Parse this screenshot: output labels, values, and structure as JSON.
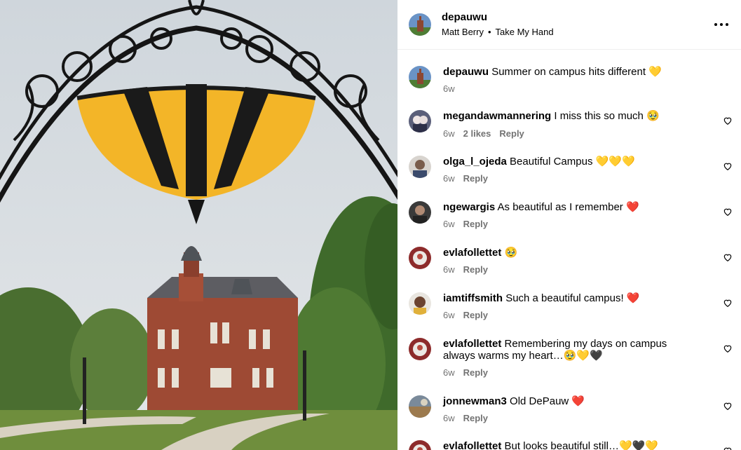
{
  "colors": {
    "gold": "#F3B528",
    "meta_gray": "#737373",
    "red_heart": "#E41E3F"
  },
  "post": {
    "username": "depauwu",
    "audio_artist": "Matt Berry",
    "audio_track": "Take My Hand",
    "more_icon": "more-horizontal-icon"
  },
  "comments": [
    {
      "user": "depauwu",
      "text": "Summer on campus hits different 💛",
      "time": "6w",
      "likes": "",
      "reply": "",
      "like_icon": ""
    },
    {
      "user": "megandawmannering",
      "text": "I miss this so much 🥹",
      "time": "6w",
      "likes": "2 likes",
      "reply": "Reply",
      "like_icon": "heart-outline-icon"
    },
    {
      "user": "olga_l_ojeda",
      "text": "Beautiful Campus 💛💛💛",
      "time": "6w",
      "likes": "",
      "reply": "Reply",
      "like_icon": "heart-outline-icon"
    },
    {
      "user": "ngewargis",
      "text": "As beautiful as I remember ❤️",
      "time": "6w",
      "likes": "",
      "reply": "Reply",
      "like_icon": "heart-outline-icon"
    },
    {
      "user": "evlafollettet",
      "text": "🥹",
      "time": "6w",
      "likes": "",
      "reply": "Reply",
      "like_icon": "heart-outline-icon"
    },
    {
      "user": "iamtiffsmith",
      "text": "Such a beautiful campus! ❤️",
      "time": "6w",
      "likes": "",
      "reply": "Reply",
      "like_icon": "heart-outline-icon"
    },
    {
      "user": "evlafollettet",
      "text": "Remembering my days on campus always warms my heart…🥹💛🖤",
      "time": "6w",
      "likes": "",
      "reply": "Reply",
      "like_icon": "heart-outline-icon"
    },
    {
      "user": "jonnewman3",
      "text": "Old DePauw ❤️",
      "time": "6w",
      "likes": "",
      "reply": "Reply",
      "like_icon": "heart-outline-icon"
    },
    {
      "user": "evlafollettet",
      "text": "But looks beautiful still…💛🖤💛",
      "time": "",
      "likes": "",
      "reply": "",
      "like_icon": "heart-outline-icon"
    }
  ]
}
